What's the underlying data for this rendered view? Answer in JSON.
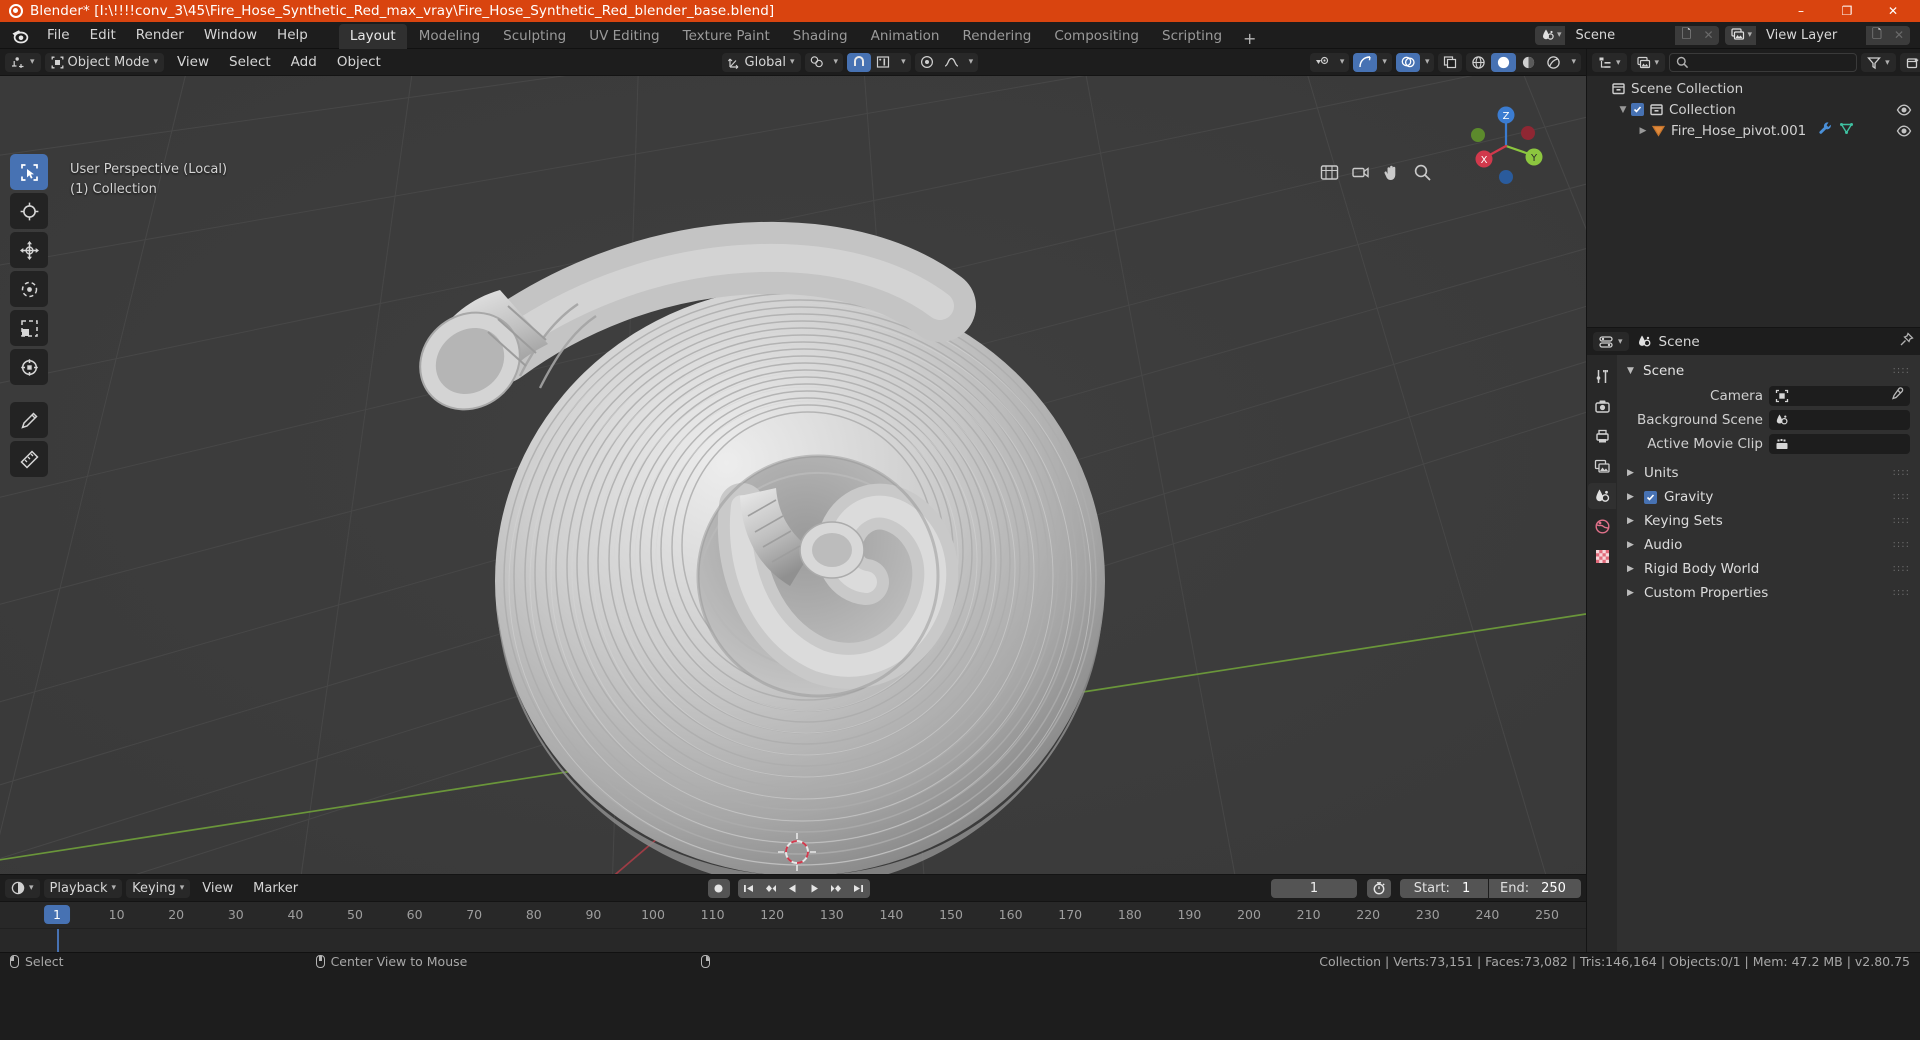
{
  "titlebar": {
    "title": "Blender* [I:\\!!!!conv_3\\45\\Fire_Hose_Synthetic_Red_max_vray\\Fire_Hose_Synthetic_Red_blender_base.blend]",
    "minimize": "–",
    "maximize": "❐",
    "close": "✕"
  },
  "topbar": {
    "menus": [
      "File",
      "Edit",
      "Render",
      "Window",
      "Help"
    ],
    "workspaces": [
      {
        "label": "Layout",
        "active": true
      },
      {
        "label": "Modeling",
        "active": false
      },
      {
        "label": "Sculpting",
        "active": false
      },
      {
        "label": "UV Editing",
        "active": false
      },
      {
        "label": "Texture Paint",
        "active": false
      },
      {
        "label": "Shading",
        "active": false
      },
      {
        "label": "Animation",
        "active": false
      },
      {
        "label": "Rendering",
        "active": false
      },
      {
        "label": "Compositing",
        "active": false
      },
      {
        "label": "Scripting",
        "active": false
      }
    ],
    "add_workspace": "+",
    "scene_name": "Scene",
    "view_layer_name": "View Layer"
  },
  "viewport_header": {
    "mode": "Object Mode",
    "menus": [
      "View",
      "Select",
      "Add",
      "Object"
    ],
    "transform_orientation": "Global"
  },
  "viewport": {
    "perspective_label": "User Perspective (Local)",
    "collection_label": "(1) Collection",
    "gizmo_axes": {
      "x": "X",
      "y": "Y",
      "z": "Z"
    },
    "colors": {
      "x_axis": "#d1394c",
      "y_axis": "#8cc63f",
      "z_axis": "#3b7cd1",
      "accent": "#4772b3",
      "background": "#3d3d3d"
    }
  },
  "outliner": {
    "search_placeholder": "",
    "rows": [
      {
        "name": "Scene Collection",
        "level": 0,
        "icon": "collection-icon",
        "has_disclosure": false,
        "has_checkbox": false,
        "eye": false
      },
      {
        "name": "Collection",
        "level": 1,
        "icon": "collection-icon",
        "has_disclosure": true,
        "has_checkbox": true,
        "eye": true
      },
      {
        "name": "Fire_Hose_pivot.001",
        "level": 2,
        "icon": "mesh-object-icon",
        "has_disclosure": true,
        "has_checkbox": false,
        "eye": true
      }
    ]
  },
  "properties": {
    "breadcrumb": "Scene",
    "panel_title": "Scene",
    "fields": [
      {
        "label": "Camera",
        "value": "",
        "icon": "camera-icon",
        "has_eyedropper": true
      },
      {
        "label": "Background Scene",
        "value": "",
        "icon": "scene-icon",
        "has_eyedropper": false
      },
      {
        "label": "Active Movie Clip",
        "value": "",
        "icon": "clip-icon",
        "has_eyedropper": false
      }
    ],
    "sections": [
      {
        "label": "Units",
        "checkbox": false
      },
      {
        "label": "Gravity",
        "checkbox": true
      },
      {
        "label": "Keying Sets",
        "checkbox": false
      },
      {
        "label": "Audio",
        "checkbox": false
      },
      {
        "label": "Rigid Body World",
        "checkbox": false
      },
      {
        "label": "Custom Properties",
        "checkbox": false
      }
    ]
  },
  "timeline": {
    "menus": [
      "Playback",
      "Keying",
      "View",
      "Marker"
    ],
    "current_frame": "1",
    "start_label": "Start:",
    "start_value": "1",
    "end_label": "End:",
    "end_value": "250",
    "ticks": [
      "1",
      "10",
      "20",
      "30",
      "40",
      "50",
      "60",
      "70",
      "80",
      "90",
      "100",
      "110",
      "120",
      "130",
      "140",
      "150",
      "160",
      "170",
      "180",
      "190",
      "200",
      "210",
      "220",
      "230",
      "240",
      "250"
    ]
  },
  "statusbar": {
    "hints": [
      {
        "mouse": "left",
        "label": "Select"
      },
      {
        "mouse": "middle",
        "label": "Center View to Mouse"
      },
      {
        "mouse": "right",
        "label": ""
      }
    ],
    "stats": "Collection | Verts:73,151 | Faces:73,082 | Tris:146,164 | Objects:0/1 | Mem: 47.2 MB | v2.80.75"
  }
}
